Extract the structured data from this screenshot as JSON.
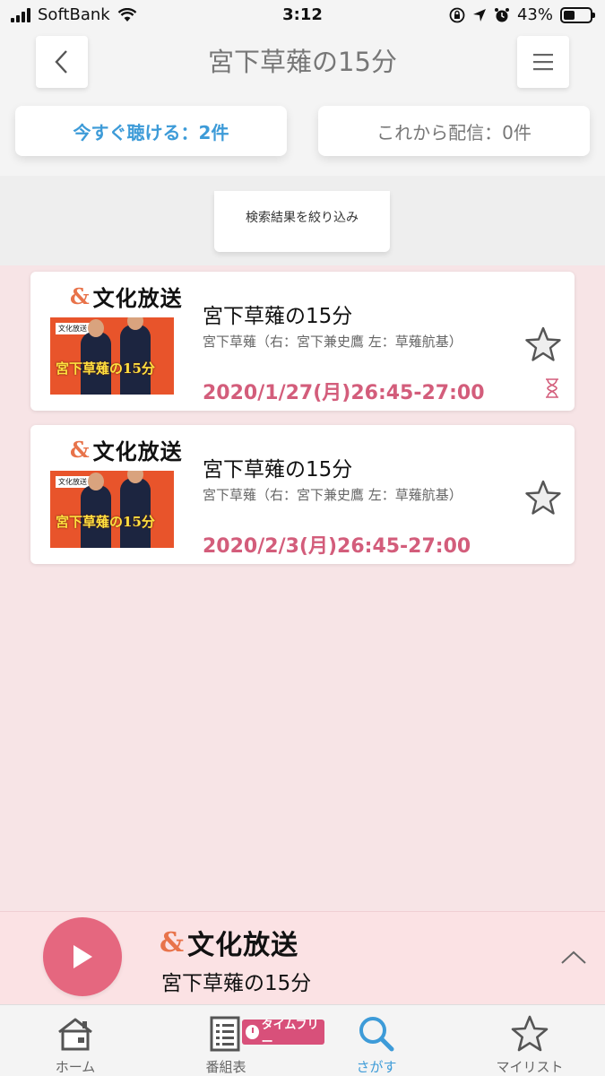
{
  "status_bar": {
    "carrier": "SoftBank",
    "time": "3:12",
    "battery_percent": "43%",
    "battery_level": 0.43
  },
  "header": {
    "title": "宮下草薙の15分",
    "tabs": [
      {
        "label": "今すぐ聴ける：2件",
        "active": true
      },
      {
        "label": "これから配信：0件",
        "active": false
      }
    ],
    "filter_label": "検索結果を絞り込み"
  },
  "results": [
    {
      "station": "文化放送",
      "thumbnail_caption": "宮下草薙の15分",
      "thumbnail_logo": "文化放送",
      "title": "宮下草薙の15分",
      "performers": "宮下草薙（右：宮下兼史鷹 左：草薙航基）",
      "datetime": "2020/1/27(月)26:45-27:00",
      "expiring": true
    },
    {
      "station": "文化放送",
      "thumbnail_caption": "宮下草薙の15分",
      "thumbnail_logo": "文化放送",
      "title": "宮下草薙の15分",
      "performers": "宮下草薙（右：宮下兼史鷹 左：草薙航基）",
      "datetime": "2020/2/3(月)26:45-27:00",
      "expiring": false
    }
  ],
  "player": {
    "station": "文化放送",
    "title": "宮下草薙の15分"
  },
  "tabbar": {
    "items": [
      {
        "label": "ホーム",
        "icon": "home-icon",
        "active": false
      },
      {
        "label": "番組表",
        "icon": "program-guide-icon",
        "active": false
      },
      {
        "label": "さがす",
        "icon": "search-icon",
        "active": true
      },
      {
        "label": "マイリスト",
        "icon": "star-icon",
        "active": false
      }
    ],
    "timefree_badge": "タイムフリー"
  },
  "colors": {
    "accent_blue": "#3d9bd8",
    "accent_pink": "#d35d7b",
    "play_pink": "#e5677f",
    "background_pink": "#f7e4e6"
  }
}
